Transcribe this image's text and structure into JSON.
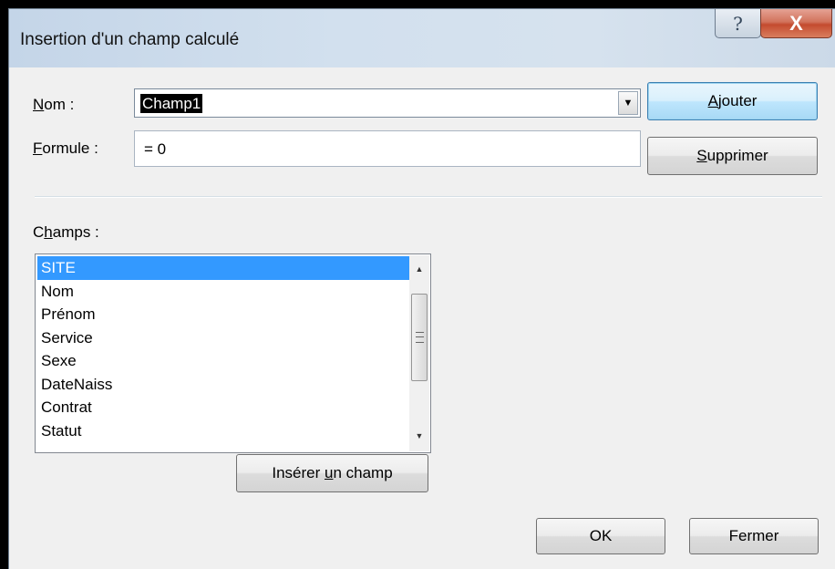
{
  "window": {
    "title": "Insertion d'un champ calculé",
    "help_glyph": "?",
    "close_glyph": "X"
  },
  "form": {
    "name_label_accel": "N",
    "name_label_rest": "om :",
    "name_value": "Champ1",
    "formula_label_accel": "F",
    "formula_label_rest": "ormule :",
    "formula_value": "= 0"
  },
  "buttons": {
    "add_accel": "A",
    "add_rest": "jouter",
    "delete_accel": "S",
    "delete_rest": "upprimer",
    "insert_before": "Insérer ",
    "insert_accel": "u",
    "insert_after": "n champ",
    "ok_label": "OK",
    "close_label": "Fermer"
  },
  "fields": {
    "label_pre": "C",
    "label_accel": "h",
    "label_post": "amps :",
    "items": [
      "SITE",
      "Nom",
      "Prénom",
      "Service",
      "Sexe",
      "DateNaiss",
      "Contrat",
      "Statut"
    ],
    "selected_index": 0
  },
  "colors": {
    "selection": "#3399ff",
    "close_button": "#c44b2f",
    "default_button_border": "#3c7fb1"
  },
  "icons": {
    "dropdown": "chevron-down-icon",
    "scroll_up": "scroll-up-arrow-icon",
    "scroll_down": "scroll-down-arrow-icon"
  }
}
